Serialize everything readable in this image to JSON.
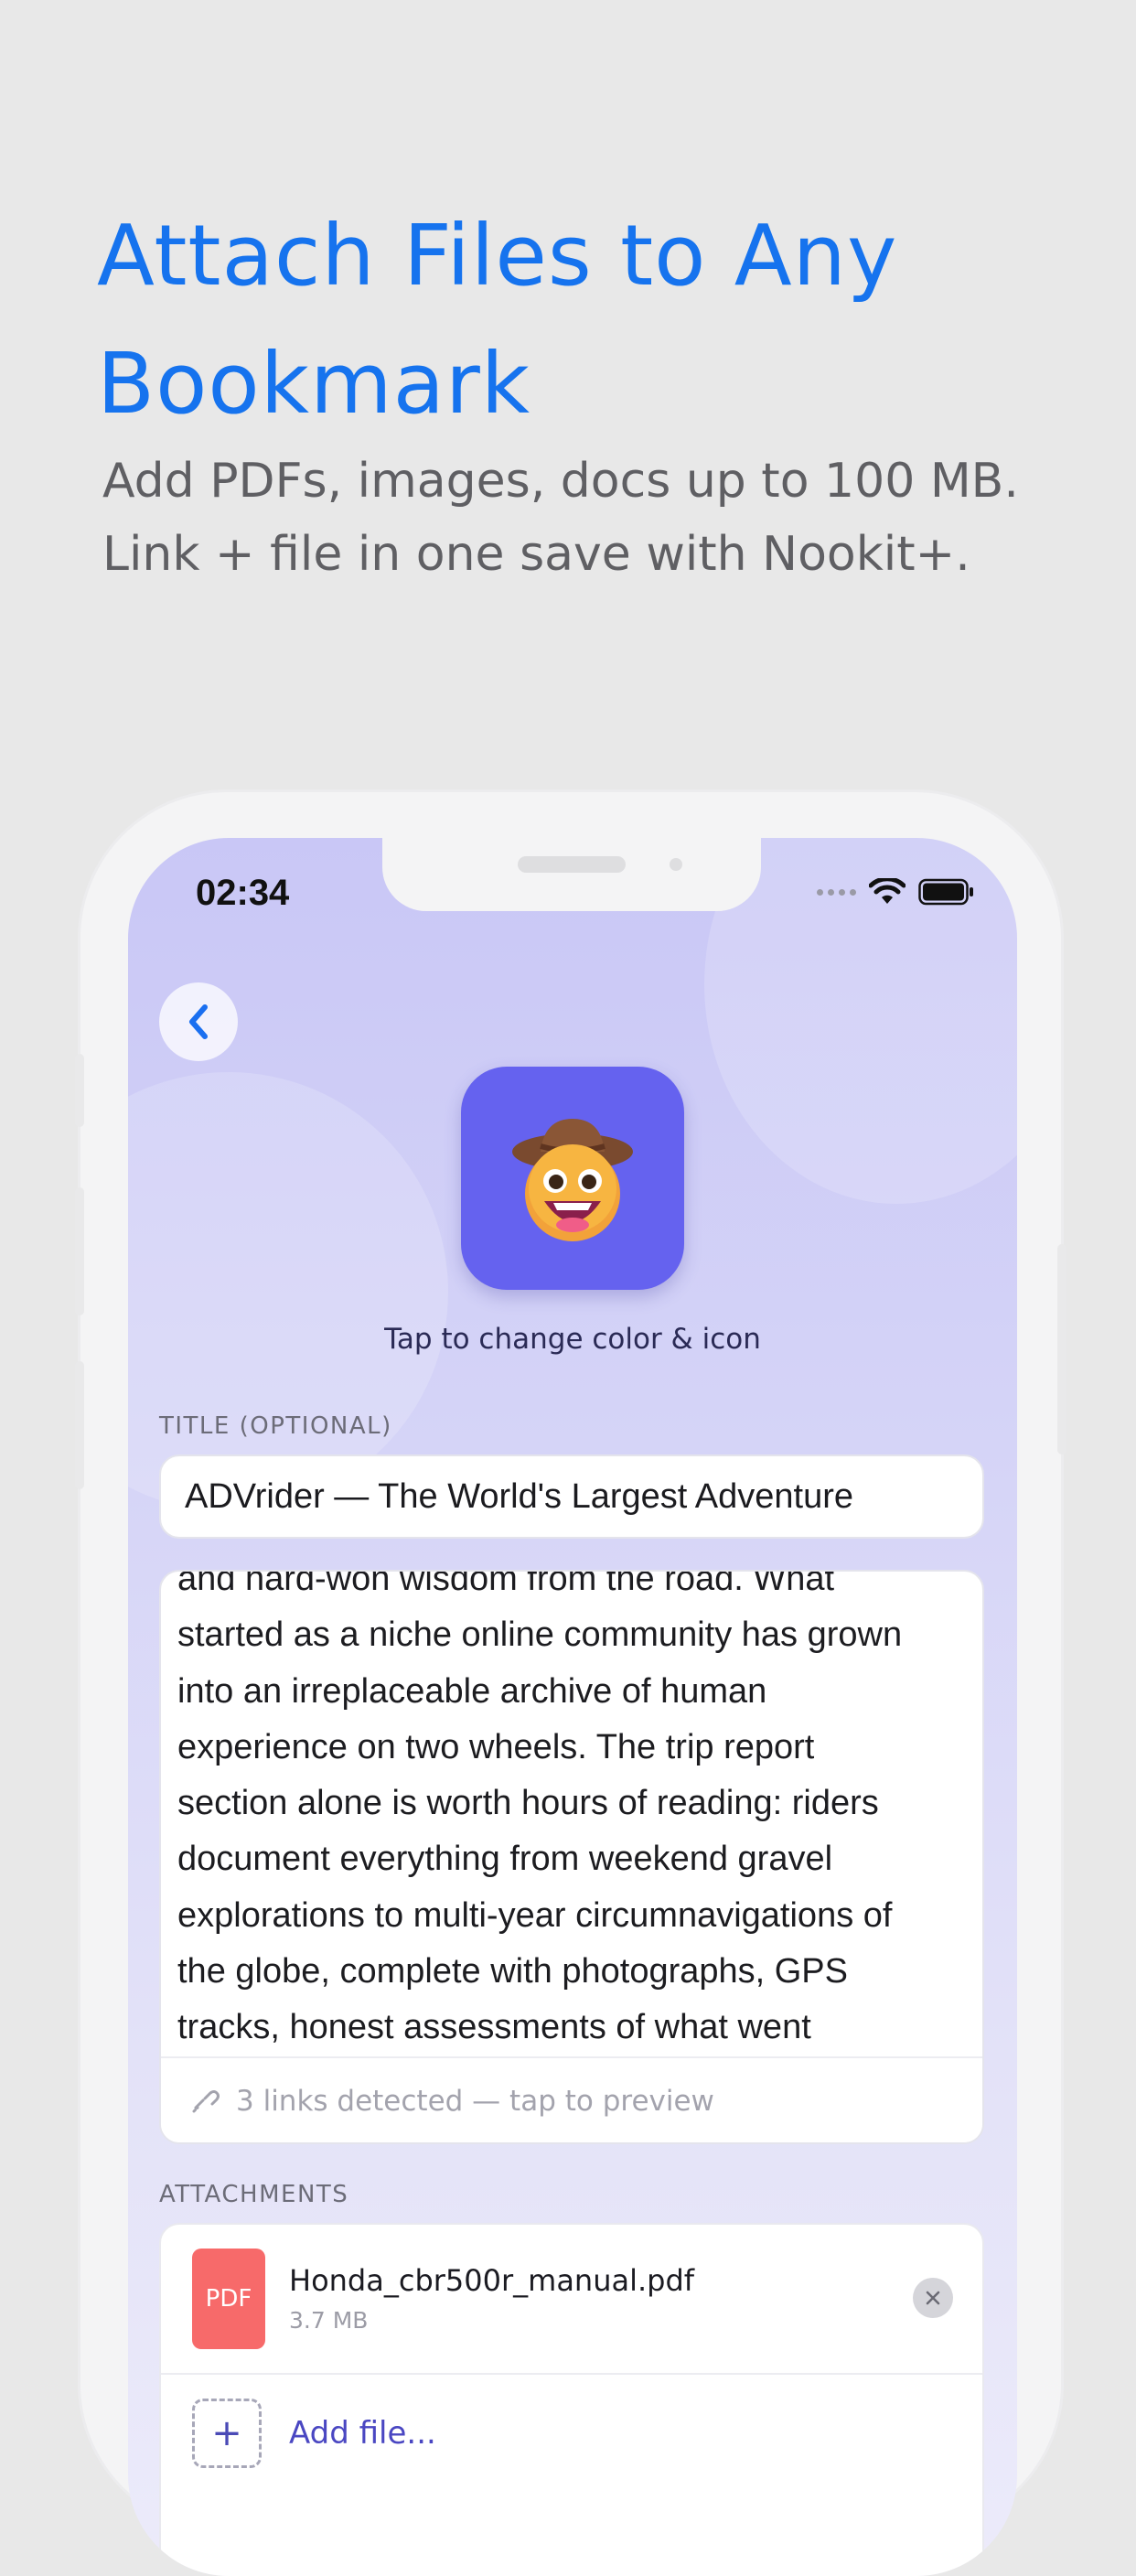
{
  "promo": {
    "headline_line1": "Attach Files to Any",
    "headline_line2": "Bookmark",
    "subline_line1": "Add PDFs, images, docs up to 100 MB.",
    "subline_line2": "Link + file in one save with Nookit+."
  },
  "status_bar": {
    "time": "02:34"
  },
  "editor": {
    "change_caption": "Tap to change color & icon",
    "title_label": "TITLE (OPTIONAL)",
    "title_value": "ADVrider — The World's Largest Adventure",
    "notes_lines": [
      "and hard-won wisdom from the road. What",
      "started as a niche online community has grown",
      "into an irreplaceable archive of human",
      "experience on two wheels. The trip report",
      "section alone is worth hours of reading: riders",
      "document everything from weekend gravel",
      "explorations to multi-year circumnavigations of",
      "the globe, complete with photographs, GPS",
      "tracks, honest assessments of what went"
    ],
    "links_detected": "3 links detected — tap to preview",
    "attachments_label": "ATTACHMENTS",
    "attachment": {
      "type_badge": "PDF",
      "file_name": "Honda_cbr500r_manual.pdf",
      "file_size": "3.7 MB"
    },
    "add_file_label": "Add file..."
  },
  "colors": {
    "accent": "#1673ee",
    "icon_bg": "#6562ef",
    "pdf_badge": "#f76a6a",
    "add_link": "#4a47c2"
  },
  "icons": [
    "back-chevron-icon",
    "cowboy-emoji-icon",
    "wifi-icon",
    "battery-icon",
    "link-icon",
    "close-icon",
    "plus-icon"
  ]
}
